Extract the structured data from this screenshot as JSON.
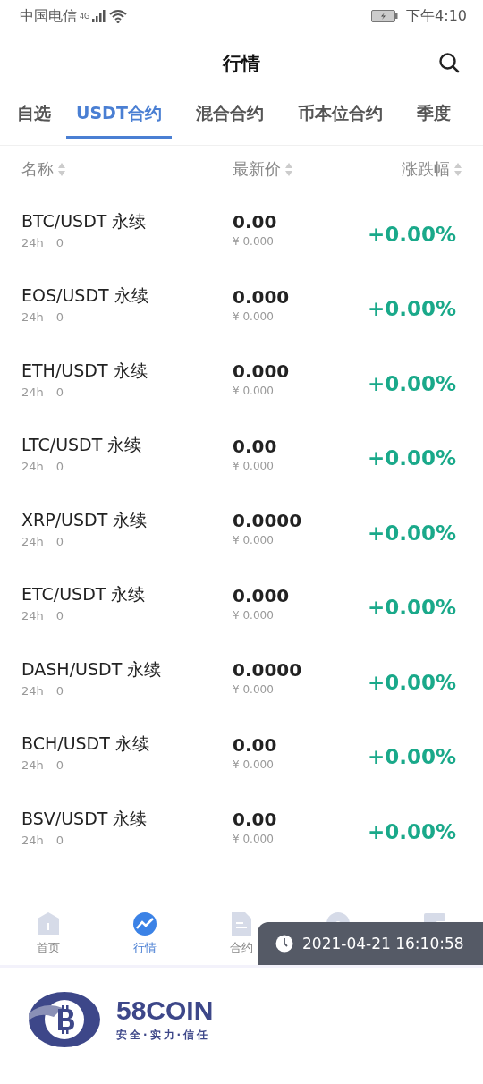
{
  "status_bar": {
    "carrier": "中国电信",
    "network": "4G",
    "time": "下午4:10"
  },
  "header": {
    "title": "行情"
  },
  "tabs": [
    {
      "label": "自选",
      "selected": false
    },
    {
      "label": "USDT合约",
      "selected": true
    },
    {
      "label": "混合合约",
      "selected": false
    },
    {
      "label": "币本位合约",
      "selected": false
    },
    {
      "label": "季度",
      "selected": false
    }
  ],
  "columns": [
    "名称",
    "最新价",
    "涨跌幅"
  ],
  "rows": [
    {
      "name": "BTC/USDT 永续",
      "volume_label": "24h",
      "volume": "0",
      "price": "0.00",
      "cny": "¥ 0.000",
      "change": "+0.00%"
    },
    {
      "name": "EOS/USDT 永续",
      "volume_label": "24h",
      "volume": "0",
      "price": "0.000",
      "cny": "¥ 0.000",
      "change": "+0.00%"
    },
    {
      "name": "ETH/USDT 永续",
      "volume_label": "24h",
      "volume": "0",
      "price": "0.000",
      "cny": "¥ 0.000",
      "change": "+0.00%"
    },
    {
      "name": "LTC/USDT 永续",
      "volume_label": "24h",
      "volume": "0",
      "price": "0.00",
      "cny": "¥ 0.000",
      "change": "+0.00%"
    },
    {
      "name": "XRP/USDT 永续",
      "volume_label": "24h",
      "volume": "0",
      "price": "0.0000",
      "cny": "¥ 0.000",
      "change": "+0.00%"
    },
    {
      "name": "ETC/USDT 永续",
      "volume_label": "24h",
      "volume": "0",
      "price": "0.000",
      "cny": "¥ 0.000",
      "change": "+0.00%"
    },
    {
      "name": "DASH/USDT 永续",
      "volume_label": "24h",
      "volume": "0",
      "price": "0.0000",
      "cny": "¥ 0.000",
      "change": "+0.00%"
    },
    {
      "name": "BCH/USDT 永续",
      "volume_label": "24h",
      "volume": "0",
      "price": "0.00",
      "cny": "¥ 0.000",
      "change": "+0.00%"
    },
    {
      "name": "BSV/USDT 永续",
      "volume_label": "24h",
      "volume": "0",
      "price": "0.00",
      "cny": "¥ 0.000",
      "change": "+0.00%"
    }
  ],
  "bottom_nav": [
    {
      "kind": "home",
      "label": "首页",
      "selected": false
    },
    {
      "kind": "chart",
      "label": "行情",
      "selected": true
    },
    {
      "kind": "document",
      "label": "合约",
      "selected": false
    },
    {
      "kind": "exchange",
      "selected": false
    },
    {
      "kind": "wallet",
      "selected": false
    }
  ],
  "timestamp": "2021-04-21 16:10:58",
  "logo": {
    "name": "58COIN",
    "slogan": "安全·实力·信任"
  }
}
